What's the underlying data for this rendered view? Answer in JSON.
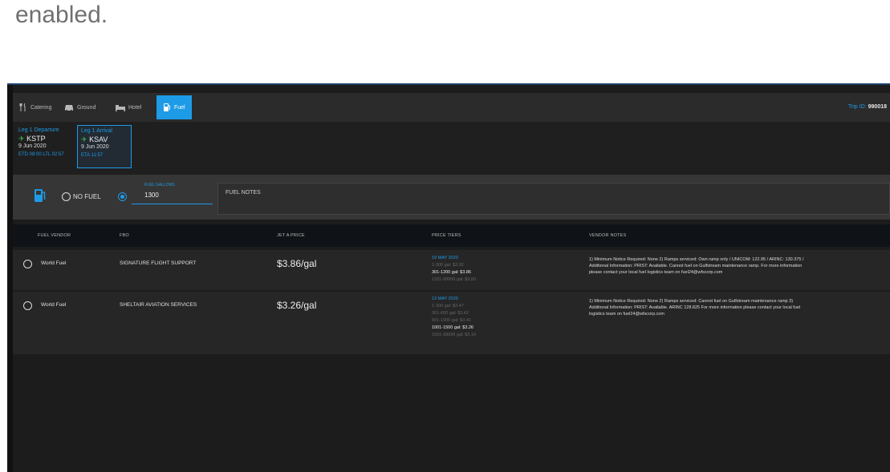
{
  "intro_text": "enabled.",
  "tabs": [
    {
      "label": "Catering",
      "icon": "utensils-icon"
    },
    {
      "label": "Ground",
      "icon": "car-icon"
    },
    {
      "label": "Hotel",
      "icon": "bed-icon"
    },
    {
      "label": "Fuel",
      "icon": "fuel-icon",
      "active": true
    }
  ],
  "trip": {
    "label": "Trip ID:",
    "value": "990018"
  },
  "legs": [
    {
      "title": "Leg 1 Departure",
      "code": "KSTP",
      "date": "9 Jun 2020",
      "status": "ETD 08:00 LTL 02:57",
      "selected": false
    },
    {
      "title": "Leg 1 Arrival",
      "code": "KSAV",
      "date": "9 Jun 2020",
      "status": "ETA 11:57",
      "selected": true
    }
  ],
  "fuel": {
    "no_fuel_label": "NO FUEL",
    "gallons_label": "FUEL GALLONS",
    "gallons_value": "1300",
    "notes_placeholder": "FUEL NOTES"
  },
  "columns": [
    "FUEL VENDOR",
    "FBO",
    "JET A PRICE",
    "PRICE TIERS",
    "VENDOR NOTES"
  ],
  "rows": [
    {
      "vendor": "World Fuel",
      "fbo": "SIGNATURE FLIGHT SUPPORT",
      "price": "$3.86/gal",
      "tiers_date": "19 MAY 2020",
      "tiers": [
        {
          "text": "1-300 gal: $3.92",
          "hl": false
        },
        {
          "text": "301-1200 gal: $3.86",
          "hl": true
        },
        {
          "text": "1201-99999 gal: $3.80",
          "hl": false
        }
      ],
      "notes": [
        "1) Minimum Notice Required: None 2) Ramps serviced: Own ramp only / UNICOM: 122.95 / ARINC: 130.375 /",
        "Additional Information: PRIST: Available. Cannot fuel on Gulfstream maintenance ramp. For more information",
        "please contact your local fuel logistics team on fuel24@wfscorp.com"
      ]
    },
    {
      "vendor": "World Fuel",
      "fbo": "SHELTAIR AVIATION SERVICES",
      "price": "$3.26/gal",
      "tiers_date": "13 MAY 2020",
      "tiers": [
        {
          "text": "1-300 gal: $3.47",
          "hl": false
        },
        {
          "text": "301-600 gal: $3.42",
          "hl": false
        },
        {
          "text": "601-1000 gal: $3.41",
          "hl": false
        },
        {
          "text": "1001-1500 gal: $3.26",
          "hl": true
        },
        {
          "text": "1501-99999 gal: $3.16",
          "hl": false
        }
      ],
      "notes": [
        "1) Minimum Notice Required: None 2) Ramps serviced: Cannot fuel on Gulfstream maintenance ramp 3)",
        "Additional Information: PRIST: Available. ARINC 128.825 For more information please contact your local fuel",
        "logistics team on fuel24@wfscorp.com"
      ]
    }
  ],
  "colors": {
    "accent": "#1e9be6",
    "status_green": "#3bb54a",
    "bg": "#1c1c1c"
  }
}
